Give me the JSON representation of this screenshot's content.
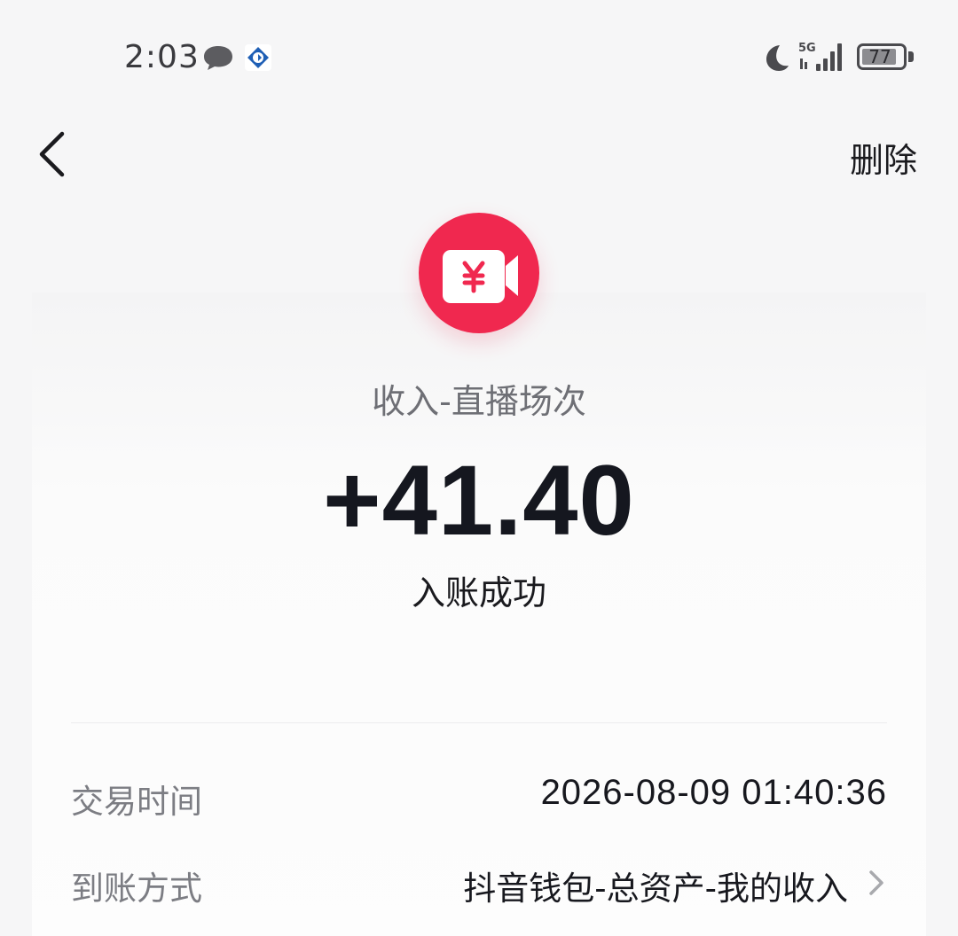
{
  "status_bar": {
    "time": "2:03",
    "network": "5G",
    "battery": "77",
    "icons": [
      "chat-bubble-icon",
      "app-notification-icon",
      "moon-icon",
      "signal-icon",
      "battery-icon"
    ]
  },
  "nav": {
    "back_icon": "back-chevron-icon",
    "delete_label": "删除"
  },
  "transaction": {
    "icon": "live-video-yuan-icon",
    "icon_color": "#f0284f",
    "type": "收入-直播场次",
    "amount": "+41.40",
    "status": "入账成功"
  },
  "details": [
    {
      "label": "交易时间",
      "value": "2026-08-09 01:40:36"
    },
    {
      "label": "到账方式",
      "value": "抖音钱包-总资产-我的收入"
    }
  ]
}
